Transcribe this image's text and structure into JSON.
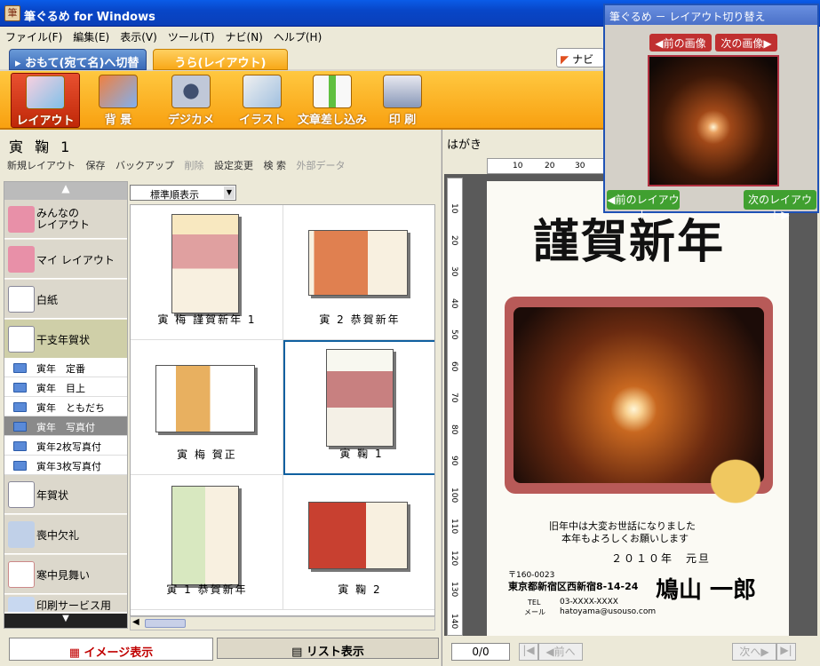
{
  "window": {
    "title": "筆ぐるめ for Windows",
    "app_icon": "筆"
  },
  "menu": [
    "ファイル(F)",
    "編集(E)",
    "表示(V)",
    "ツール(T)",
    "ナビ(N)",
    "ヘルプ(H)"
  ],
  "tabs": {
    "front": "おもて(宛て名)へ切替",
    "back": "うら(レイアウト)",
    "navi": "ナビ"
  },
  "toolbar": [
    {
      "label": "レイアウト",
      "icon": "layout-icon",
      "active": true
    },
    {
      "label": "背 景",
      "icon": "background-icon"
    },
    {
      "label": "デジカメ",
      "icon": "camera-icon"
    },
    {
      "label": "イラスト",
      "icon": "illustration-icon"
    },
    {
      "label": "文章差し込み",
      "icon": "text-insert-icon"
    },
    {
      "label": "印 刷",
      "icon": "printer-icon"
    }
  ],
  "left": {
    "title": "寅 鞠 1",
    "tools": [
      "新規レイアウト",
      "保存",
      "バックアップ",
      "削除",
      "設定変更",
      "検 索",
      "外部データ"
    ],
    "sort": "標準順表示",
    "sidebar": [
      {
        "label": "みんなの\nレイアウト",
        "icon": "people-icon"
      },
      {
        "label": "マイ レイアウト",
        "icon": "person-icon"
      },
      {
        "label": "白紙",
        "icon": "blank-page-icon"
      },
      {
        "label": "干支年賀状",
        "icon": "zodiac-card-icon"
      }
    ],
    "subitems": [
      "寅年　定番",
      "寅年　目上",
      "寅年　ともだち",
      "寅年　写真付",
      "寅年2枚写真付",
      "寅年3枚写真付"
    ],
    "sidebar_lower": [
      {
        "label": "年賀状",
        "icon": "newyear-card-icon"
      },
      {
        "label": "喪中欠礼",
        "icon": "mourning-icon"
      },
      {
        "label": "寒中見舞い",
        "icon": "snowman-icon"
      },
      {
        "label": "印刷サービス用",
        "icon": "print-service-icon"
      }
    ],
    "grid": [
      {
        "caption": "寅 梅 謹賀新年 1"
      },
      {
        "caption": "寅 2 恭賀新年"
      },
      {
        "caption": "寅 梅 賀正"
      },
      {
        "caption": "寅 鞠 1"
      },
      {
        "caption": "寅 1 恭賀新年"
      },
      {
        "caption": "寅 鞠 2"
      }
    ],
    "view_tabs": {
      "image": "イメージ表示",
      "list": "リスト表示"
    }
  },
  "right": {
    "label": "はがき",
    "ruler_top": [
      "10",
      "20",
      "30"
    ],
    "ruler_left": [
      "10",
      "20",
      "30",
      "40",
      "50",
      "60",
      "70",
      "80",
      "90",
      "100",
      "110",
      "120",
      "130",
      "140"
    ],
    "card": {
      "greeting": "謹賀新年",
      "message_1": "旧年中は大変お世話になりました",
      "message_2": "本年もよろしくお願いします",
      "date": "２０１０年　元旦",
      "zip": "〒160-0023",
      "address": "東京都新宿区西新宿8-14-24",
      "name": "鳩山 一郎",
      "tel_label": "TEL",
      "tel": "03-XXXX-XXXX",
      "mail_label": "メール",
      "mail": "hatoyama@usouso.com"
    },
    "pager": {
      "page": "0/0",
      "prev": "前へ",
      "next": "次へ"
    }
  },
  "float": {
    "title": "筆ぐるめ － レイアウト切り替え",
    "prev_image": "前の画像",
    "next_image": "次の画像",
    "prev_layout": "前のレイアウト",
    "next_layout": "次のレイアウト"
  }
}
